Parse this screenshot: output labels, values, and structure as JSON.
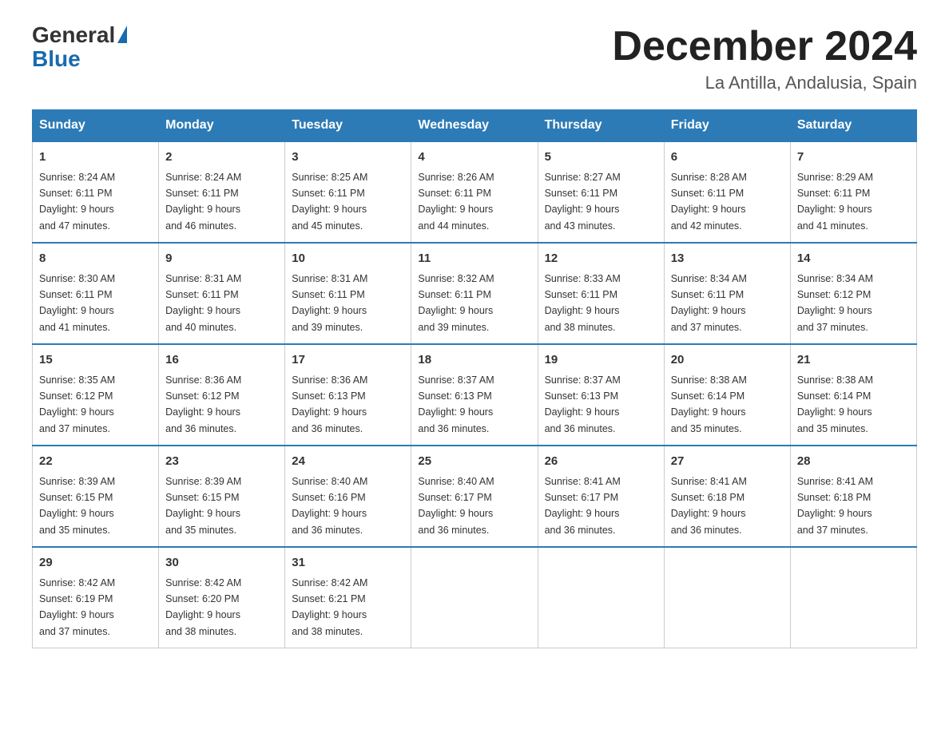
{
  "logo": {
    "text_general": "General",
    "text_blue": "Blue"
  },
  "calendar": {
    "title": "December 2024",
    "subtitle": "La Antilla, Andalusia, Spain"
  },
  "headers": [
    "Sunday",
    "Monday",
    "Tuesday",
    "Wednesday",
    "Thursday",
    "Friday",
    "Saturday"
  ],
  "weeks": [
    [
      {
        "day": "1",
        "sunrise": "8:24 AM",
        "sunset": "6:11 PM",
        "daylight": "9 hours and 47 minutes."
      },
      {
        "day": "2",
        "sunrise": "8:24 AM",
        "sunset": "6:11 PM",
        "daylight": "9 hours and 46 minutes."
      },
      {
        "day": "3",
        "sunrise": "8:25 AM",
        "sunset": "6:11 PM",
        "daylight": "9 hours and 45 minutes."
      },
      {
        "day": "4",
        "sunrise": "8:26 AM",
        "sunset": "6:11 PM",
        "daylight": "9 hours and 44 minutes."
      },
      {
        "day": "5",
        "sunrise": "8:27 AM",
        "sunset": "6:11 PM",
        "daylight": "9 hours and 43 minutes."
      },
      {
        "day": "6",
        "sunrise": "8:28 AM",
        "sunset": "6:11 PM",
        "daylight": "9 hours and 42 minutes."
      },
      {
        "day": "7",
        "sunrise": "8:29 AM",
        "sunset": "6:11 PM",
        "daylight": "9 hours and 41 minutes."
      }
    ],
    [
      {
        "day": "8",
        "sunrise": "8:30 AM",
        "sunset": "6:11 PM",
        "daylight": "9 hours and 41 minutes."
      },
      {
        "day": "9",
        "sunrise": "8:31 AM",
        "sunset": "6:11 PM",
        "daylight": "9 hours and 40 minutes."
      },
      {
        "day": "10",
        "sunrise": "8:31 AM",
        "sunset": "6:11 PM",
        "daylight": "9 hours and 39 minutes."
      },
      {
        "day": "11",
        "sunrise": "8:32 AM",
        "sunset": "6:11 PM",
        "daylight": "9 hours and 39 minutes."
      },
      {
        "day": "12",
        "sunrise": "8:33 AM",
        "sunset": "6:11 PM",
        "daylight": "9 hours and 38 minutes."
      },
      {
        "day": "13",
        "sunrise": "8:34 AM",
        "sunset": "6:11 PM",
        "daylight": "9 hours and 37 minutes."
      },
      {
        "day": "14",
        "sunrise": "8:34 AM",
        "sunset": "6:12 PM",
        "daylight": "9 hours and 37 minutes."
      }
    ],
    [
      {
        "day": "15",
        "sunrise": "8:35 AM",
        "sunset": "6:12 PM",
        "daylight": "9 hours and 37 minutes."
      },
      {
        "day": "16",
        "sunrise": "8:36 AM",
        "sunset": "6:12 PM",
        "daylight": "9 hours and 36 minutes."
      },
      {
        "day": "17",
        "sunrise": "8:36 AM",
        "sunset": "6:13 PM",
        "daylight": "9 hours and 36 minutes."
      },
      {
        "day": "18",
        "sunrise": "8:37 AM",
        "sunset": "6:13 PM",
        "daylight": "9 hours and 36 minutes."
      },
      {
        "day": "19",
        "sunrise": "8:37 AM",
        "sunset": "6:13 PM",
        "daylight": "9 hours and 36 minutes."
      },
      {
        "day": "20",
        "sunrise": "8:38 AM",
        "sunset": "6:14 PM",
        "daylight": "9 hours and 35 minutes."
      },
      {
        "day": "21",
        "sunrise": "8:38 AM",
        "sunset": "6:14 PM",
        "daylight": "9 hours and 35 minutes."
      }
    ],
    [
      {
        "day": "22",
        "sunrise": "8:39 AM",
        "sunset": "6:15 PM",
        "daylight": "9 hours and 35 minutes."
      },
      {
        "day": "23",
        "sunrise": "8:39 AM",
        "sunset": "6:15 PM",
        "daylight": "9 hours and 35 minutes."
      },
      {
        "day": "24",
        "sunrise": "8:40 AM",
        "sunset": "6:16 PM",
        "daylight": "9 hours and 36 minutes."
      },
      {
        "day": "25",
        "sunrise": "8:40 AM",
        "sunset": "6:17 PM",
        "daylight": "9 hours and 36 minutes."
      },
      {
        "day": "26",
        "sunrise": "8:41 AM",
        "sunset": "6:17 PM",
        "daylight": "9 hours and 36 minutes."
      },
      {
        "day": "27",
        "sunrise": "8:41 AM",
        "sunset": "6:18 PM",
        "daylight": "9 hours and 36 minutes."
      },
      {
        "day": "28",
        "sunrise": "8:41 AM",
        "sunset": "6:18 PM",
        "daylight": "9 hours and 37 minutes."
      }
    ],
    [
      {
        "day": "29",
        "sunrise": "8:42 AM",
        "sunset": "6:19 PM",
        "daylight": "9 hours and 37 minutes."
      },
      {
        "day": "30",
        "sunrise": "8:42 AM",
        "sunset": "6:20 PM",
        "daylight": "9 hours and 38 minutes."
      },
      {
        "day": "31",
        "sunrise": "8:42 AM",
        "sunset": "6:21 PM",
        "daylight": "9 hours and 38 minutes."
      },
      null,
      null,
      null,
      null
    ]
  ],
  "labels": {
    "sunrise": "Sunrise:",
    "sunset": "Sunset:",
    "daylight": "Daylight:"
  }
}
